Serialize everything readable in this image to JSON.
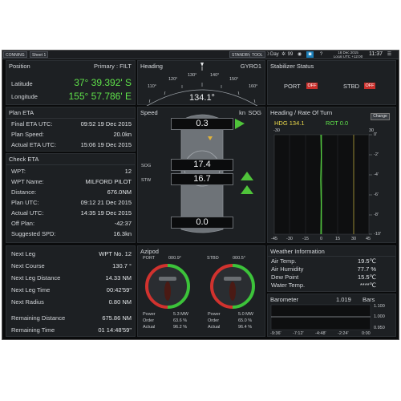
{
  "topbar": {
    "conning": "CONNING",
    "sheet": "Sheet 1",
    "standby": "STANDBY",
    "tool": "TOOL",
    "day_label": "Day",
    "brightness_value": "99",
    "date": "18 Dec 2015",
    "local_time_label": "Local UTC +12:00",
    "time": "11:37"
  },
  "position": {
    "title": "Position",
    "source": "Primary : FILT",
    "lat_label": "Latitude",
    "lat_value": "37° 39.392' S",
    "lon_label": "Longitude",
    "lon_value": "155° 57.786' E"
  },
  "plan_eta": {
    "title": "Plan ETA",
    "rows": [
      {
        "label": "Final ETA UTC:",
        "value": "09:52 19 Dec 2015"
      },
      {
        "label": "Plan Speed:",
        "value": "20.0kn"
      },
      {
        "label": "Actual ETA UTC:",
        "value": "15:06 19 Dec 2015"
      }
    ]
  },
  "check_eta": {
    "title": "Check ETA",
    "rows": [
      {
        "label": "WPT:",
        "value": "12"
      },
      {
        "label": "WPT Name:",
        "value": "MILFORD PILOT"
      },
      {
        "label": "Distance:",
        "value": "676.0NM"
      },
      {
        "label": "Plan UTC:",
        "value": "09:12 21 Dec 2015"
      },
      {
        "label": "Actual UTC:",
        "value": "14:35 19 Dec 2015"
      },
      {
        "label": "Off Plan:",
        "value": "-42:37"
      },
      {
        "label": "Suggested SPD:",
        "value": "16.3kn"
      }
    ]
  },
  "next_leg": {
    "rows": [
      {
        "label": "Next Leg",
        "value": "WPT No. 12"
      },
      {
        "label": "Next Course",
        "value": "130.7 °"
      },
      {
        "label": "Next Leg Distance",
        "value": "14.33 NM"
      },
      {
        "label": "Next Leg Time",
        "value": "00:42'59\""
      },
      {
        "label": "Next Radius",
        "value": "0.80 NM"
      },
      {
        "label": "Remaining Distance",
        "value": "675.86 NM"
      },
      {
        "label": "Remaining Time",
        "value": "01 14:48'59\""
      }
    ]
  },
  "heading": {
    "title": "Heading",
    "source": "GYRO1",
    "ticks": [
      "110°",
      "120°",
      "130°",
      "140°",
      "150°",
      "160°"
    ],
    "value": "134.1°"
  },
  "speed": {
    "title": "Speed",
    "unit": "kn",
    "mode": "SOG",
    "top_value": "0.3",
    "sog_label": "SOG",
    "stw_label": "STW",
    "sog_value": "17.4",
    "stw_value": "16.7",
    "bottom_value": "0.0"
  },
  "azipod": {
    "title": "Azipod",
    "port": {
      "name": "PORT",
      "angle": "000.9°",
      "power_label": "Power",
      "power": "5.3 MW",
      "order_label": "Order",
      "order": "63.6 %",
      "actual_label": "Actual",
      "actual": "96.2 %"
    },
    "stbd": {
      "name": "STBD",
      "angle": "000.5°",
      "power_label": "Power",
      "power": "5.0 MW",
      "order_label": "Order",
      "order": "65.0 %",
      "actual_label": "Actual",
      "actual": "96.4 %"
    }
  },
  "stabilizer": {
    "title": "Stabilizer Status",
    "port_label": "PORT",
    "port_state": "OFF",
    "stbd_label": "STBD",
    "stbd_state": "OFF"
  },
  "rot": {
    "title": "Heading / Rate Of Turn",
    "hdg": "HDG 134.1",
    "rot": "ROT 0.0",
    "change_label": "Change",
    "x_ticks": [
      "-45",
      "-30",
      "-15",
      "0",
      "15",
      "30",
      "45"
    ],
    "y_ticks": [
      "0'",
      "-2'",
      "-4'",
      "-6'",
      "-8'",
      "-10'"
    ]
  },
  "weather": {
    "title": "Weather Information",
    "rows": [
      {
        "label": "Air Temp.",
        "value": "19.5℃"
      },
      {
        "label": "Air Humidity",
        "value": "77.7 %"
      },
      {
        "label": "Dew Point",
        "value": "15.5℃"
      },
      {
        "label": "Water Temp.",
        "value": "****℃"
      }
    ]
  },
  "barometer": {
    "title": "Barometer",
    "value": "1.019",
    "unit": "Bars",
    "y_ticks": [
      "1.100",
      "1.000",
      "0.950"
    ],
    "x_ticks": [
      "-9:36'",
      "-7:12'",
      "-4:48'",
      "-2:24'",
      "0:00"
    ]
  },
  "colors": {
    "accent_green": "#5fe24a",
    "off_red": "#c9302c",
    "panel": "#1d2023"
  }
}
